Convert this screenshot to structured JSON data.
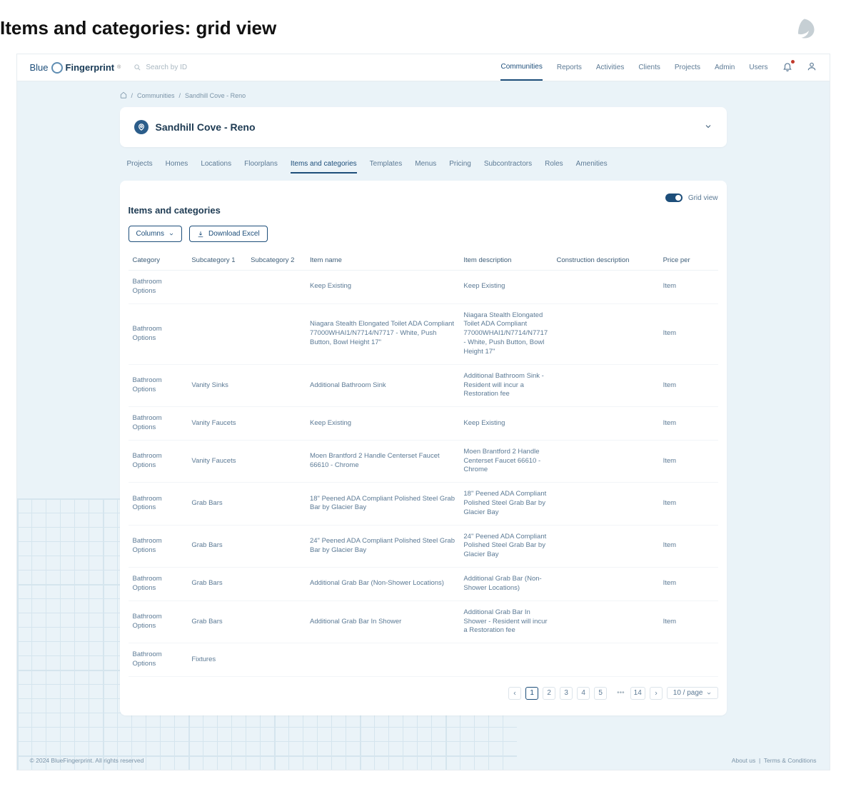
{
  "outer_title": "Items and categories: grid view",
  "brand": {
    "left": "Blue",
    "right": "Fingerprint"
  },
  "search": {
    "placeholder": "Search by ID"
  },
  "topnav": [
    "Communities",
    "Reports",
    "Activities",
    "Clients",
    "Projects",
    "Admin",
    "Users"
  ],
  "topnav_active": 0,
  "breadcrumb": {
    "root": "Communities",
    "leaf": "Sandhill Cove - Reno"
  },
  "page_title": "Sandhill Cove - Reno",
  "subtabs": [
    "Projects",
    "Homes",
    "Locations",
    "Floorplans",
    "Items and categories",
    "Templates",
    "Menus",
    "Pricing",
    "Subcontractors",
    "Roles",
    "Amenities"
  ],
  "subtabs_active": 4,
  "grid_view": {
    "label": "Grid view"
  },
  "section_heading": "Items and categories",
  "toolbar": {
    "columns": "Columns",
    "download": "Download Excel"
  },
  "columns": [
    "Category",
    "Subcategory 1",
    "Subcategory 2",
    "Item name",
    "Item description",
    "Construction description",
    "Price per"
  ],
  "rows": [
    {
      "category": "Bathroom Options",
      "sub1": "",
      "sub2": "",
      "item_name": "Keep Existing",
      "item_desc": "Keep Existing",
      "constr": "",
      "price_per": "Item"
    },
    {
      "category": "Bathroom Options",
      "sub1": "",
      "sub2": "",
      "item_name": "Niagara Stealth Elongated Toilet ADA Compliant 77000WHAI1/N7714/N7717 - White, Push Button, Bowl Height 17\"",
      "item_desc": "Niagara Stealth Elongated Toilet ADA Compliant 77000WHAI1/N7714/N7717 - White, Push Button, Bowl Height 17\"",
      "constr": "",
      "price_per": "Item"
    },
    {
      "category": "Bathroom Options",
      "sub1": "Vanity Sinks",
      "sub2": "",
      "item_name": "Additional Bathroom Sink",
      "item_desc": "Additional Bathroom Sink - Resident will incur a Restoration fee",
      "constr": "",
      "price_per": "Item"
    },
    {
      "category": "Bathroom Options",
      "sub1": "Vanity Faucets",
      "sub2": "",
      "item_name": "Keep Existing",
      "item_desc": "Keep Existing",
      "constr": "",
      "price_per": "Item"
    },
    {
      "category": "Bathroom Options",
      "sub1": "Vanity Faucets",
      "sub2": "",
      "item_name": "Moen Brantford 2 Handle Centerset Faucet 66610 - Chrome",
      "item_desc": "Moen Brantford 2 Handle Centerset Faucet 66610 - Chrome",
      "constr": "",
      "price_per": "Item"
    },
    {
      "category": "Bathroom Options",
      "sub1": "Grab Bars",
      "sub2": "",
      "item_name": "18\" Peened ADA Compliant Polished Steel Grab Bar by Glacier Bay",
      "item_desc": "18\" Peened ADA Compliant Polished Steel Grab Bar by Glacier Bay",
      "constr": "",
      "price_per": "Item"
    },
    {
      "category": "Bathroom Options",
      "sub1": "Grab Bars",
      "sub2": "",
      "item_name": "24\" Peened ADA Compliant Polished Steel Grab Bar by Glacier Bay",
      "item_desc": "24\" Peened ADA Compliant Polished Steel Grab Bar by Glacier Bay",
      "constr": "",
      "price_per": "Item"
    },
    {
      "category": "Bathroom Options",
      "sub1": "Grab Bars",
      "sub2": "",
      "item_name": "Additional Grab Bar (Non-Shower Locations)",
      "item_desc": "Additional Grab Bar (Non-Shower Locations)",
      "constr": "",
      "price_per": "Item"
    },
    {
      "category": "Bathroom Options",
      "sub1": "Grab Bars",
      "sub2": "",
      "item_name": "Additional Grab Bar In Shower",
      "item_desc": "Additional Grab Bar In Shower - Resident will incur a Restoration fee",
      "constr": "",
      "price_per": "Item"
    },
    {
      "category": "Bathroom Options",
      "sub1": "Fixtures",
      "sub2": "",
      "item_name": "",
      "item_desc": "",
      "constr": "",
      "price_per": ""
    }
  ],
  "pagination": {
    "pages": [
      "1",
      "2",
      "3",
      "4",
      "5"
    ],
    "last": "14",
    "active": "1",
    "page_size": "10 / page"
  },
  "footer": {
    "copyright": "© 2024 BlueFingerprint. All rights reserved",
    "links": [
      "About us",
      "Terms & Conditions"
    ]
  }
}
